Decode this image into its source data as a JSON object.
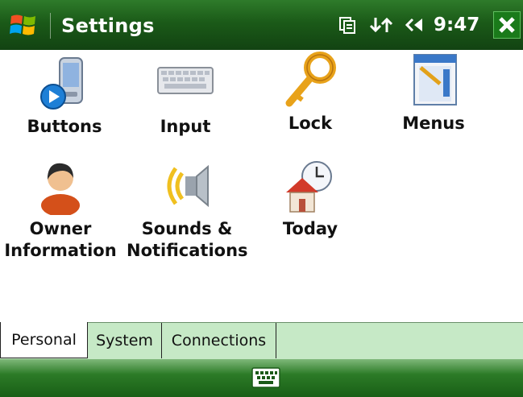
{
  "titlebar": {
    "title": "Settings",
    "time": "9:47",
    "start_icon": "windows-logo-icon",
    "status_icons": [
      "connectivity-icon",
      "sync-arrows-icon",
      "speaker-icon"
    ],
    "close_icon": "close-icon",
    "close_color": "#1a7a1a"
  },
  "items": [
    {
      "label": "Buttons",
      "icon": "buttons-device-icon"
    },
    {
      "label": "Input",
      "icon": "keyboard-icon"
    },
    {
      "label": "Lock",
      "icon": "key-icon"
    },
    {
      "label": "Menus",
      "icon": "menus-window-icon"
    },
    {
      "label_line1": "Owner",
      "label_line2": "Information",
      "icon": "owner-person-icon"
    },
    {
      "label_line1": "Sounds &",
      "label_line2": "Notifications",
      "icon": "speaker-sound-icon"
    },
    {
      "label": "Today",
      "icon": "house-clock-icon"
    }
  ],
  "tabs": [
    {
      "label": "Personal",
      "active": true
    },
    {
      "label": "System",
      "active": false
    },
    {
      "label": "Connections",
      "active": false
    }
  ],
  "bottombar": {
    "input_icon": "keyboard-input-icon"
  },
  "colors": {
    "titlebar_green": "#1b5a18",
    "tab_strip": "#c6e9c6",
    "bottom_green": "#2c7b27"
  }
}
